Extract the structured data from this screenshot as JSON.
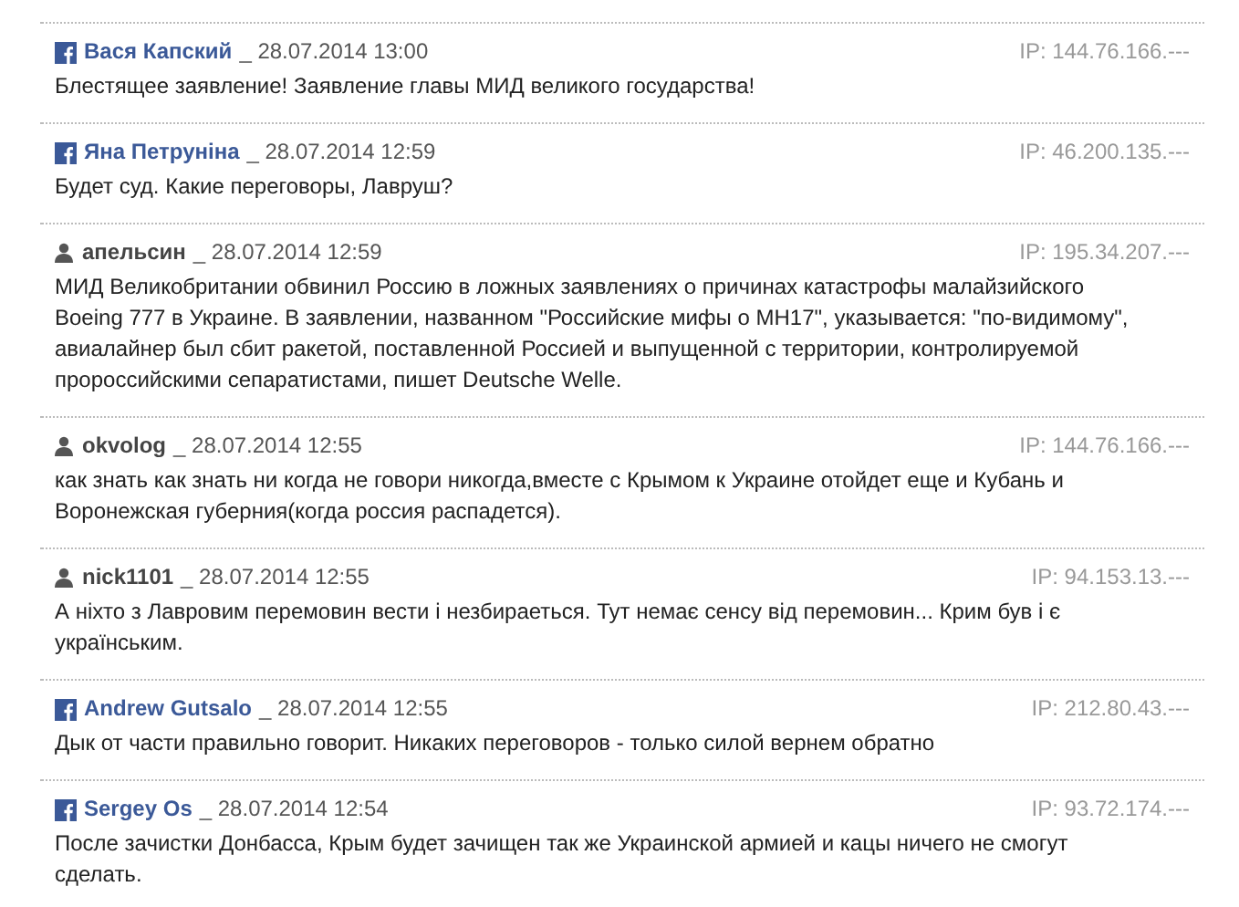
{
  "comments": [
    {
      "kind": "facebook",
      "author": "Вася Капский",
      "date": "_ 28.07.2014 13:00",
      "ip": "IP: 144.76.166.---",
      "text": "Блестящее заявление! Заявление главы МИД великого государства!"
    },
    {
      "kind": "facebook",
      "author": "Яна Петруніна",
      "date": "_ 28.07.2014 12:59",
      "ip": "IP: 46.200.135.---",
      "text": "Будет суд. Какие переговоры, Лавруш?"
    },
    {
      "kind": "user",
      "author": "апельсин",
      "date": "_ 28.07.2014 12:59",
      "ip": "IP: 195.34.207.---",
      "text": "МИД Великобритании обвинил Россию в ложных заявлениях о причинах катастрофы малайзийского Boeing 777 в Украине. В заявлении, названном \"Российские мифы о MH17\", указывается: \"по-видимому\", авиалайнер был сбит ракетой, поставленной Россией и выпущенной с территории, контролируемой пророссийскими сепаратистами, пишет Deutsche Welle."
    },
    {
      "kind": "user",
      "author": "okvolog",
      "date": "_ 28.07.2014 12:55",
      "ip": "IP: 144.76.166.---",
      "text": "как знать как знать ни когда не говори никогда,вместе с Крымом к Украине отойдет еще и Кубань и Воронежская губерния(когда россия распадется)."
    },
    {
      "kind": "user",
      "author": "nick1101",
      "date": "_ 28.07.2014 12:55",
      "ip": "IP: 94.153.13.---",
      "text": "А ніхто з Лавровим перемовин вести і незбираеться. Тут немає сенсу від перемовин... Крим був і є українським."
    },
    {
      "kind": "facebook",
      "author": "Andrew Gutsalo",
      "date": "_ 28.07.2014 12:55",
      "ip": "IP: 212.80.43.---",
      "text": "Дык от части правильно говорит. Никаких переговоров - только силой вернем обратно"
    },
    {
      "kind": "facebook",
      "author": "Sergey Os",
      "date": "_ 28.07.2014 12:54",
      "ip": "IP: 93.72.174.---",
      "text": "После зачистки Донбасса, Крым будет зачищен так же Украинской армией и кацы ничего не смогут сделать."
    }
  ]
}
